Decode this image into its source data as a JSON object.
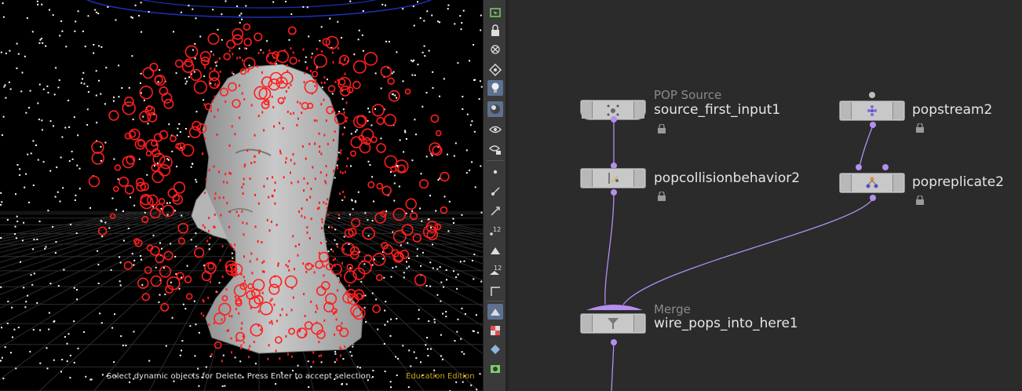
{
  "viewport": {
    "prompt": "Select dynamic objects for Delete. Press Enter to accept selection.",
    "edition_badge": "Education Edition"
  },
  "toolbar": {
    "icons": [
      "selection-mode-icon",
      "lock-icon",
      "camera-snap-icon",
      "geometry-display-icon",
      "lightbulb-icon",
      "shading-icon",
      "eye-icon",
      "eye-settings-icon",
      "point-display-icon",
      "normals-icon",
      "vector-icon",
      "point-number-icon",
      "prim-color-icon",
      "prim-number-icon",
      "bounding-box-icon",
      "shaded-icon",
      "texture-icon",
      "background-icon",
      "scene-icon"
    ],
    "point_number_label": "12",
    "prim_number_label": "12"
  },
  "network": {
    "nodes": [
      {
        "id": "source_first_input1",
        "name": "source_first_input1",
        "type": "POP Source",
        "locked": true
      },
      {
        "id": "popcollisionbehavior2",
        "name": "popcollisionbehavior2",
        "type": "",
        "locked": true
      },
      {
        "id": "popstream2",
        "name": "popstream2",
        "type": "",
        "locked": true
      },
      {
        "id": "popreplicate2",
        "name": "popreplicate2",
        "type": "",
        "locked": true
      },
      {
        "id": "wire_pops_into_here1",
        "name": "wire_pops_into_here1",
        "type": "Merge",
        "locked": false
      }
    ],
    "wire_color": "#b48ef0"
  }
}
